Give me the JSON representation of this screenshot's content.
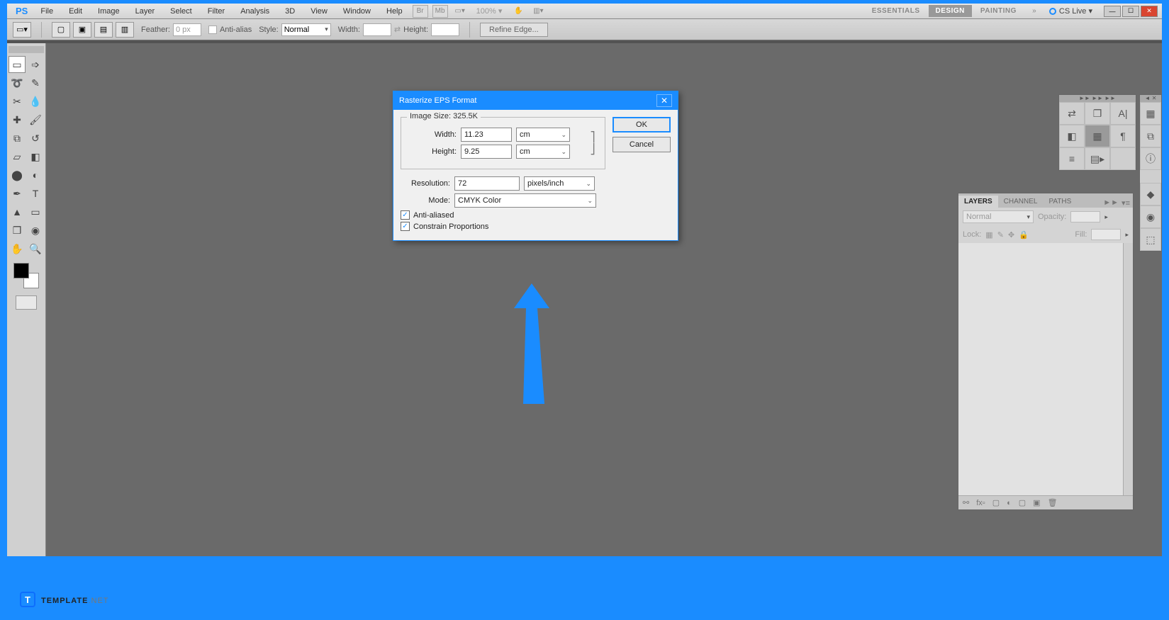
{
  "menubar": {
    "logo": "PS",
    "items": [
      "File",
      "Edit",
      "Image",
      "Layer",
      "Select",
      "Filter",
      "Analysis",
      "3D",
      "View",
      "Window",
      "Help"
    ],
    "zoom": "100% ▾",
    "workspaces": [
      "ESSENTIALS",
      "DESIGN",
      "PAINTING"
    ],
    "cslive": "CS Live ▾"
  },
  "optionbar": {
    "feather_label": "Feather:",
    "feather_value": "0 px",
    "antialias": "Anti-alias",
    "style_label": "Style:",
    "style_value": "Normal",
    "width_label": "Width:",
    "height_label": "Height:",
    "refine": "Refine Edge..."
  },
  "dialog": {
    "title": "Rasterize EPS Format",
    "image_size_label": "Image Size: 325.5K",
    "width_label": "Width:",
    "width_value": "11.23",
    "width_unit": "cm",
    "height_label": "Height:",
    "height_value": "9.25",
    "height_unit": "cm",
    "resolution_label": "Resolution:",
    "resolution_value": "72",
    "resolution_unit": "pixels/inch",
    "mode_label": "Mode:",
    "mode_value": "CMYK Color",
    "antialiased": "Anti-aliased",
    "constrain": "Constrain Proportions",
    "ok": "OK",
    "cancel": "Cancel"
  },
  "panels": {
    "tabs": [
      "LAYERS",
      "CHANNEL",
      "PATHS"
    ],
    "blend_mode": "Normal",
    "opacity_label": "Opacity:",
    "lock_label": "Lock:",
    "fill_label": "Fill:"
  },
  "watermark": {
    "icon": "T",
    "name": "TEMPLATE",
    "suffix": ".NET"
  }
}
